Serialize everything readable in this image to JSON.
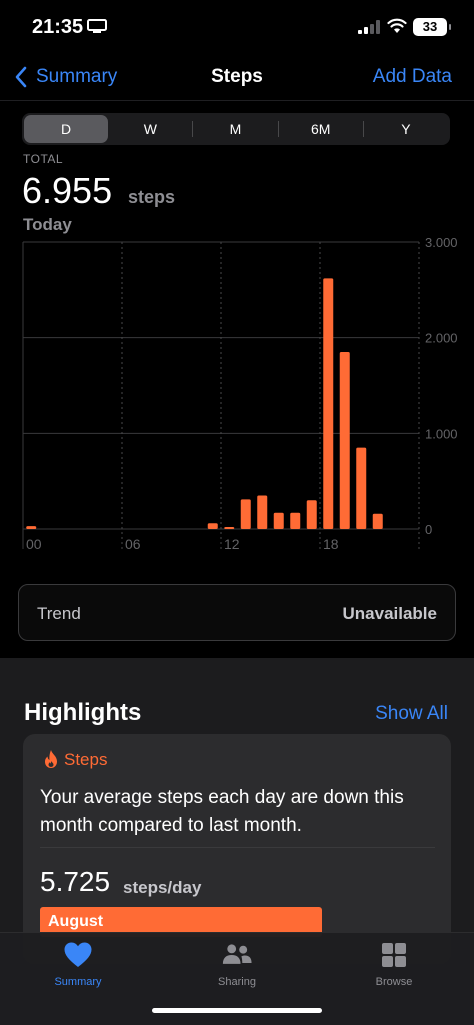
{
  "status": {
    "time": "21:35",
    "battery": "33"
  },
  "nav": {
    "back_label": "Summary",
    "title": "Steps",
    "action_label": "Add Data"
  },
  "segments": [
    "D",
    "W",
    "M",
    "6M",
    "Y"
  ],
  "summary": {
    "total_label": "TOTAL",
    "value": "6.955",
    "unit": "steps",
    "date": "Today"
  },
  "chart_data": {
    "type": "bar",
    "x_ticks": [
      "00",
      "06",
      "12",
      "18"
    ],
    "y_ticks": [
      "0",
      "1.000",
      "2.000",
      "3.000"
    ],
    "ylim": [
      0,
      3000
    ],
    "hours": [
      0,
      1,
      2,
      3,
      4,
      5,
      6,
      7,
      8,
      9,
      10,
      11,
      12,
      13,
      14,
      15,
      16,
      17,
      18,
      19,
      20,
      21,
      22,
      23
    ],
    "values": [
      30,
      0,
      0,
      0,
      0,
      0,
      0,
      0,
      0,
      0,
      0,
      60,
      20,
      310,
      350,
      170,
      170,
      300,
      2620,
      1850,
      850,
      160,
      0,
      0
    ],
    "bar_color": "#ff6b35",
    "grid": true
  },
  "trend": {
    "label": "Trend",
    "value": "Unavailable"
  },
  "highlights": {
    "title": "Highlights",
    "show_all": "Show All",
    "card": {
      "label": "Steps",
      "text": "Your average steps each day are down this month compared to last month.",
      "avg_value": "5.725",
      "avg_unit": "steps/day",
      "bar_label": "August",
      "bar_fraction": 0.66
    }
  },
  "tabs": [
    {
      "label": "Summary",
      "icon": "heart-icon"
    },
    {
      "label": "Sharing",
      "icon": "people-icon"
    },
    {
      "label": "Browse",
      "icon": "grid-icon"
    }
  ]
}
